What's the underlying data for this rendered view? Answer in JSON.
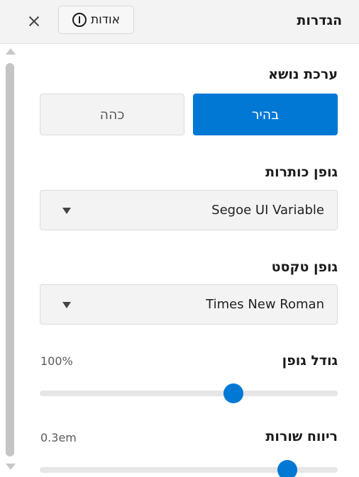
{
  "header": {
    "title": "הגדרות",
    "about_label": "אודות",
    "about_icon": "info-icon",
    "close_icon": "close-icon"
  },
  "theme": {
    "label": "ערכת נושא",
    "options": [
      "בהיר",
      "כהה"
    ],
    "selected": "בהיר"
  },
  "heading_font": {
    "label": "גופן כותרות",
    "value": "Segoe UI Variable"
  },
  "text_font": {
    "label": "גופן טקסט",
    "value": "Times New Roman"
  },
  "font_size": {
    "label": "גודל גופן",
    "value_text": "100%",
    "level": 0.65
  },
  "line_spacing": {
    "label": "ריווח שורות",
    "value_text": "0.3em",
    "level": 0.83
  },
  "colors": {
    "accent": "#0078d4",
    "header_bg": "#f3f3f3"
  }
}
